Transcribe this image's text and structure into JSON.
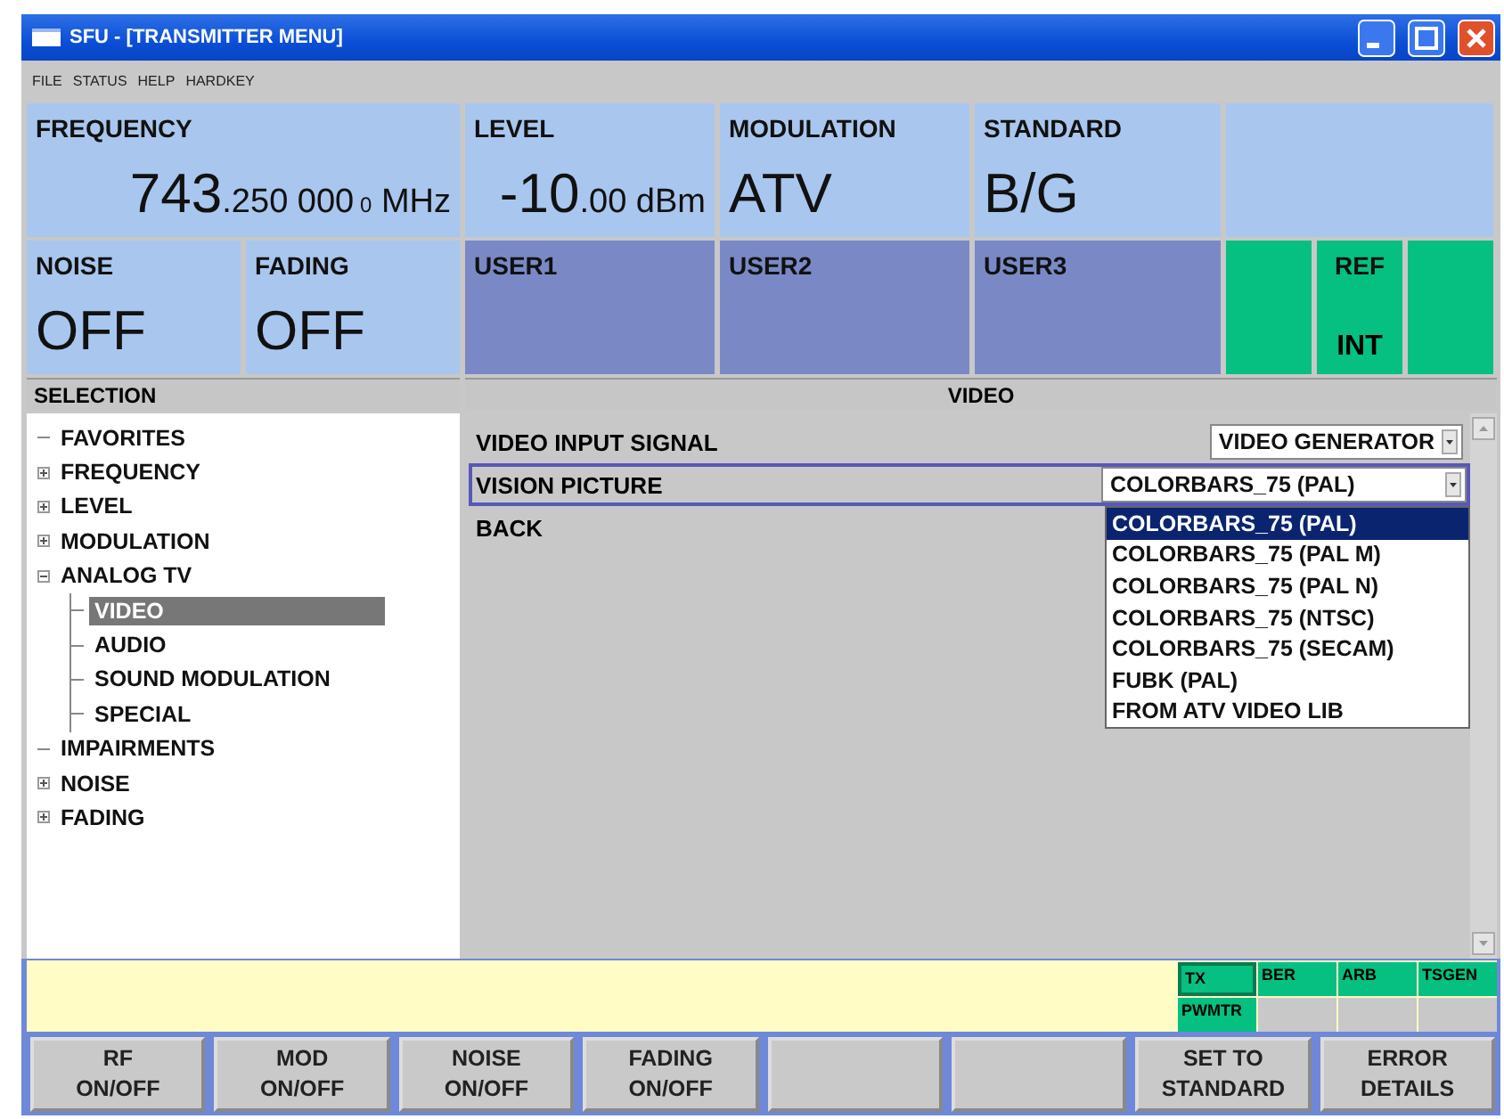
{
  "window": {
    "title": "SFU - [TRANSMITTER MENU]"
  },
  "menu": [
    "FILE",
    "STATUS",
    "HELP",
    "HARDKEY"
  ],
  "top_panels": [
    {
      "kind": "value",
      "label": "FREQUENCY",
      "value": "743",
      "value_small": ".250 000",
      "value_tiny": "0",
      "unit": "MHz"
    },
    {
      "kind": "value",
      "label": "LEVEL",
      "value": "-10",
      "value_small": ".00",
      "unit": "dBm"
    },
    {
      "kind": "value",
      "label": "MODULATION",
      "value": "ATV"
    },
    {
      "kind": "value",
      "label": "STANDARD",
      "value": "B/G"
    },
    {
      "kind": "blank"
    }
  ],
  "second_panels": [
    {
      "kind": "state",
      "label": "NOISE",
      "value": "OFF"
    },
    {
      "kind": "state",
      "label": "FADING",
      "value": "OFF"
    },
    {
      "kind": "user",
      "label": "USER1"
    },
    {
      "kind": "user",
      "label": "USER2"
    },
    {
      "kind": "user",
      "label": "USER3"
    },
    {
      "kind": "indicator"
    },
    {
      "kind": "indicator",
      "label": "REF",
      "value": "INT"
    },
    {
      "kind": "indicator"
    }
  ],
  "selection": {
    "header": "SELECTION",
    "tree": [
      {
        "label": "FAVORITES",
        "selected": false
      },
      {
        "label": "FREQUENCY",
        "selected": false,
        "expanded": false
      },
      {
        "label": "LEVEL",
        "selected": false,
        "expanded": false
      },
      {
        "label": "MODULATION",
        "selected": false,
        "expanded": false
      },
      {
        "label": "ANALOG TV",
        "selected": false,
        "expanded": true,
        "children": [
          {
            "label": "VIDEO",
            "selected": true
          },
          {
            "label": "AUDIO",
            "selected": false
          },
          {
            "label": "SOUND MODULATION",
            "selected": false
          },
          {
            "label": "SPECIAL",
            "selected": false
          }
        ]
      },
      {
        "label": "IMPAIRMENTS",
        "selected": false
      },
      {
        "label": "NOISE",
        "selected": false,
        "expanded": false
      },
      {
        "label": "FADING",
        "selected": false,
        "expanded": false
      }
    ]
  },
  "video": {
    "header": "VIDEO",
    "rows": [
      {
        "kind": "dropdown",
        "label": "VIDEO INPUT SIGNAL",
        "value": "VIDEO GENERATOR",
        "focused": false
      },
      {
        "kind": "dropdown",
        "label": "VISION PICTURE",
        "value": "COLORBARS_75 (PAL)",
        "focused": true,
        "options": [
          {
            "label": "COLORBARS_75 (PAL)",
            "selected": true
          },
          {
            "label": "COLORBARS_75 (PAL M)",
            "selected": false
          },
          {
            "label": "COLORBARS_75 (PAL N)",
            "selected": false
          },
          {
            "label": "COLORBARS_75 (NTSC)",
            "selected": false
          },
          {
            "label": "COLORBARS_75 (SECAM)",
            "selected": false
          },
          {
            "label": "FUBK (PAL)",
            "selected": false
          },
          {
            "label": "FROM ATV VIDEO LIB",
            "selected": false
          }
        ]
      },
      {
        "kind": "link",
        "label": "BACK"
      }
    ]
  },
  "status_indicators": [
    [
      {
        "label": "TX",
        "on": true,
        "selected": true
      },
      {
        "label": "BER",
        "on": true,
        "selected": false
      },
      {
        "label": "ARB",
        "on": true,
        "selected": false
      },
      {
        "label": "TSGEN",
        "on": true,
        "selected": false
      }
    ],
    [
      {
        "label": "PWMTR",
        "on": true,
        "selected": false
      },
      {
        "on": false
      },
      {
        "on": false
      },
      {
        "on": false
      }
    ]
  ],
  "softkeys": [
    {
      "kind": "label",
      "lines": [
        "RF",
        "ON/OFF"
      ]
    },
    {
      "kind": "label",
      "lines": [
        "MOD",
        "ON/OFF"
      ]
    },
    {
      "kind": "label",
      "lines": [
        "NOISE",
        "ON/OFF"
      ]
    },
    {
      "kind": "label",
      "lines": [
        "FADING",
        "ON/OFF"
      ]
    },
    {
      "kind": "blank"
    },
    {
      "kind": "blank"
    },
    {
      "kind": "label",
      "lines": [
        "SET TO",
        "STANDARD"
      ]
    },
    {
      "kind": "label",
      "lines": [
        "ERROR",
        "DETAILS"
      ]
    }
  ]
}
